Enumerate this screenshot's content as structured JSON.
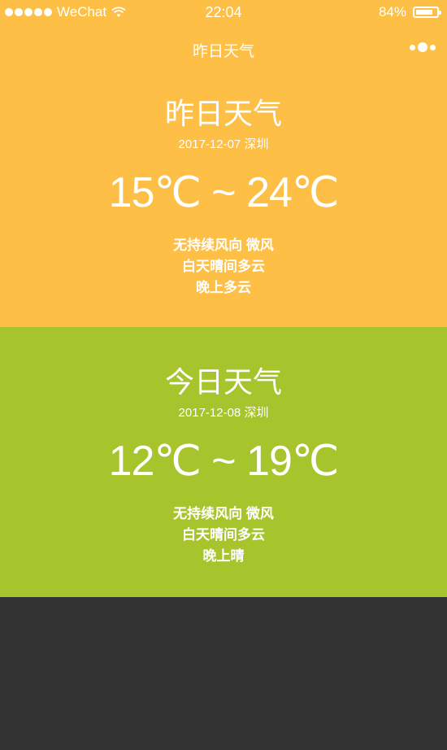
{
  "status_bar": {
    "carrier": "WeChat",
    "time": "22:04",
    "battery_percent": "84%",
    "battery_level": 0.84,
    "signal_icon": "signal-dots-icon",
    "wifi_icon": "wifi-icon"
  },
  "nav": {
    "title": "昨日天气",
    "more_icon": "more-dots-icon"
  },
  "yesterday": {
    "title": "昨日天气",
    "date": "2017-12-07 深圳",
    "temp": "15℃ ~ 24℃",
    "wind": "无持续风向 微风",
    "day": "白天晴间多云",
    "night": "晚上多云",
    "color": "#fdbf45"
  },
  "today": {
    "title": "今日天气",
    "date": "2017-12-08 深圳",
    "temp": "12℃ ~ 19℃",
    "wind": "无持续风向 微风",
    "day": "白天晴间多云",
    "night": "晚上晴",
    "color": "#a6c42b"
  },
  "colors": {
    "background": "#333333",
    "text": "#ffffff"
  }
}
